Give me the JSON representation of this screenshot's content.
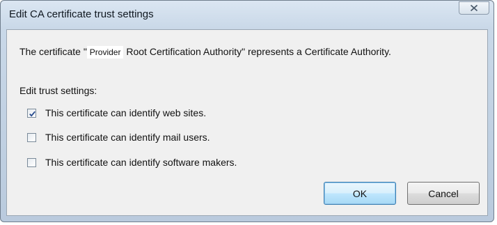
{
  "dialog": {
    "title": "Edit CA certificate trust settings",
    "message_prefix": "The certificate \"",
    "certificate_name": "Provider",
    "message_suffix": " Root Certification Authority\" represents a Certificate Authority.",
    "section_label": "Edit trust settings:",
    "options": [
      {
        "label": "This certificate can identify web sites.",
        "checked": true
      },
      {
        "label": "This certificate can identify mail users.",
        "checked": false
      },
      {
        "label": "This certificate can identify software makers.",
        "checked": false
      }
    ],
    "ok_label": "OK",
    "cancel_label": "Cancel",
    "close_icon": "close-icon"
  }
}
